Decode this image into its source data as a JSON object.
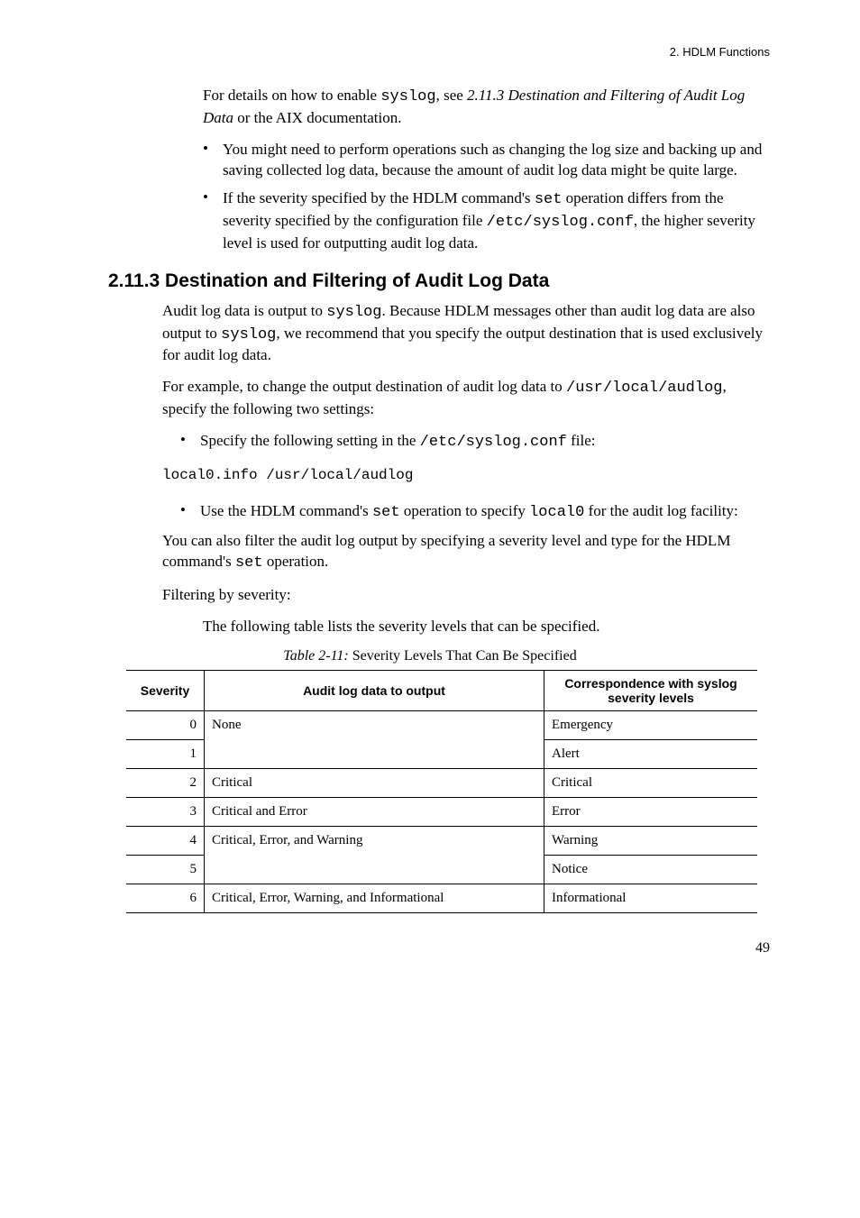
{
  "header": {
    "right": "2. HDLM Functions"
  },
  "intro": {
    "para1_a": "For details on how to enable ",
    "para1_b": ", see ",
    "para1_ref": "2.11.3  Destination and Filtering of Audit Log Data",
    "para1_c": " or the AIX documentation.",
    "code_syslog": "syslog",
    "bullet1": "You might need to perform operations such as changing the log size and backing up and saving collected log data, because the amount of audit log data might be quite large.",
    "bullet2_a": "If the severity specified by the HDLM command's ",
    "bullet2_set": "set",
    "bullet2_b": " operation differs from the severity specified by the configuration file ",
    "bullet2_path": "/etc/syslog.conf",
    "bullet2_c": ", the higher severity level is used for outputting audit log data."
  },
  "section": {
    "heading": "2.11.3  Destination and Filtering of Audit Log Data",
    "p1_a": "Audit log data is output to ",
    "p1_syslog": "syslog",
    "p1_b": ". Because HDLM messages other than audit log data are also output to ",
    "p1_c": ", we recommend that you specify the output destination that is used exclusively for audit log data.",
    "p2_a": "For example, to change the output destination of audit log data to ",
    "p2_path": "/usr/local/audlog",
    "p2_b": ", specify the following two settings:",
    "b1_a": "Specify the following setting in the ",
    "b1_path": "/etc/syslog.conf",
    "b1_b": " file:",
    "code_line": "local0.info /usr/local/audlog",
    "b2_a": "Use the HDLM command's ",
    "b2_set": "set",
    "b2_b": " operation to specify ",
    "b2_local0": "local0",
    "b2_c": " for the audit log facility:",
    "p3_a": "You can also filter the audit log output by specifying a severity level and type for the HDLM command's ",
    "p3_set": "set",
    "p3_b": " operation.",
    "p4": "Filtering by severity:",
    "p5": "The following table lists the severity levels that can be specified."
  },
  "table": {
    "caption_label": "Table  2-11:  ",
    "caption_text": "Severity Levels That Can Be Specified",
    "headers": {
      "c1": "Severity",
      "c2": "Audit log data to output",
      "c3": "Correspondence with syslog severity levels"
    }
  },
  "chart_data": {
    "type": "table",
    "title": "Severity Levels That Can Be Specified",
    "columns": [
      "Severity",
      "Audit log data to output",
      "Correspondence with syslog severity levels"
    ],
    "rows": [
      {
        "severity": "0",
        "output": "None",
        "corr": "Emergency"
      },
      {
        "severity": "1",
        "output": "",
        "corr": "Alert"
      },
      {
        "severity": "2",
        "output": "Critical",
        "corr": "Critical"
      },
      {
        "severity": "3",
        "output": "Critical and Error",
        "corr": "Error"
      },
      {
        "severity": "4",
        "output": "Critical, Error, and Warning",
        "corr": "Warning"
      },
      {
        "severity": "5",
        "output": "",
        "corr": "Notice"
      },
      {
        "severity": "6",
        "output": "Critical, Error, Warning, and Informational",
        "corr": "Informational"
      }
    ]
  },
  "page_number": "49"
}
